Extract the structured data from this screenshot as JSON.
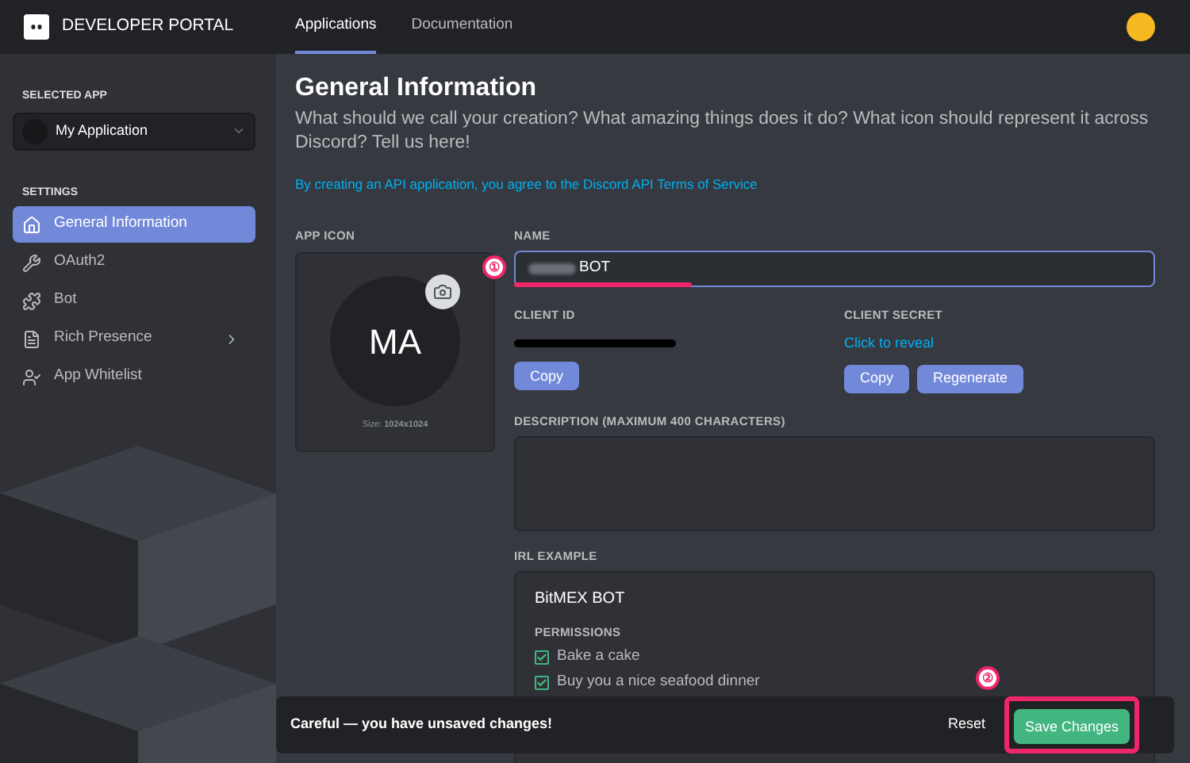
{
  "header": {
    "brand": "DEVELOPER PORTAL",
    "tabs": [
      {
        "label": "Applications",
        "selected": true
      },
      {
        "label": "Documentation",
        "selected": false
      }
    ]
  },
  "sidebar": {
    "selected_app_label": "SELECTED APP",
    "selected_app": "My Application",
    "settings_label": "SETTINGS",
    "items": [
      {
        "label": "General Information",
        "selected": true,
        "chevron": false
      },
      {
        "label": "OAuth2",
        "selected": false,
        "chevron": false
      },
      {
        "label": "Bot",
        "selected": false,
        "chevron": false
      },
      {
        "label": "Rich Presence",
        "selected": false,
        "chevron": true
      },
      {
        "label": "App Whitelist",
        "selected": false,
        "chevron": false
      }
    ]
  },
  "page": {
    "title": "General Information",
    "subtitle": "What should we call your creation? What amazing things does it do? What icon should represent it across Discord? Tell us here!",
    "terms_link": "By creating an API application, you agree to the Discord API Terms of Service"
  },
  "app_icon": {
    "label": "APP ICON",
    "initials": "MA",
    "size_note": "Size: **1024x1024**"
  },
  "name_field": {
    "label": "NAME",
    "value": "BOT",
    "annotation": "①"
  },
  "client_id": {
    "label": "CLIENT ID",
    "buttons": [
      "Copy"
    ]
  },
  "client_secret": {
    "label": "CLIENT SECRET",
    "reveal": "Click to reveal",
    "buttons": [
      "Copy",
      "Regenerate"
    ]
  },
  "description_field": {
    "label": "DESCRIPTION (MAXIMUM 400 CHARACTERS)"
  },
  "irl_example": {
    "label": "IRL EXAMPLE",
    "bot_name": "BitMEX BOT",
    "permissions_label": "PERMISSIONS",
    "permissions": [
      {
        "label": "Bake a cake",
        "checked": true
      },
      {
        "label": "Buy you a nice seafood dinner",
        "checked": true
      }
    ]
  },
  "unsaved_bar": {
    "message": "Careful — you have unsaved changes!",
    "reset": "Reset",
    "save": "Save Changes",
    "annotation": "②"
  }
}
